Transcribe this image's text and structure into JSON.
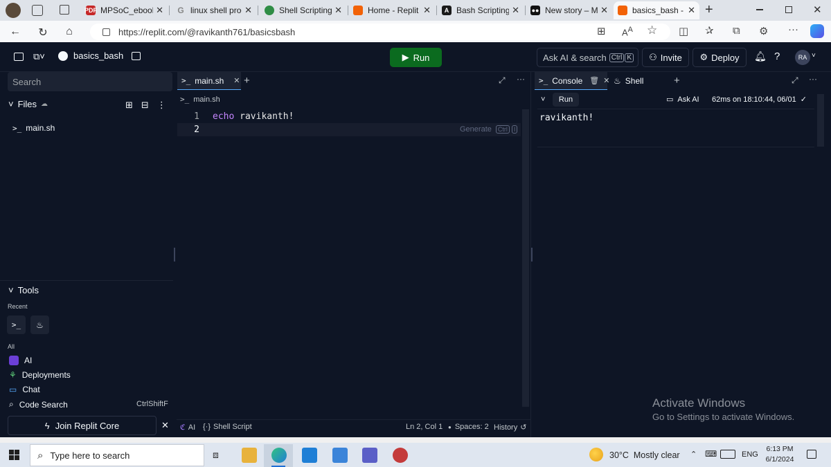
{
  "browser": {
    "tabs": [
      {
        "title": "MPSoC_ebook",
        "favicon": "pdf-icon",
        "color": "#c62828"
      },
      {
        "title": "linux shell prog",
        "favicon": "google-icon",
        "color": "#ffffff"
      },
      {
        "title": "Shell Scripting",
        "favicon": "green-circle-icon",
        "color": "#2f8d46"
      },
      {
        "title": "Home - Replit",
        "favicon": "replit-icon",
        "color": "#f26207"
      },
      {
        "title": "Bash Scripting",
        "favicon": "bash-a-icon",
        "color": "#1a1a1a"
      },
      {
        "title": "New story – Me",
        "favicon": "medium-icon",
        "color": "#111111"
      },
      {
        "title": "basics_bash - R",
        "favicon": "replit-icon",
        "color": "#f26207"
      }
    ],
    "url": "https://replit.com/@ravikanth761/basicsbash"
  },
  "replit": {
    "project_name": "basics_bash",
    "run_label": "Run",
    "ask_ai": "Ask AI & search",
    "ask_ai_kbd1": "Ctrl",
    "ask_ai_kbd2": "K",
    "invite": "Invite",
    "deploy": "Deploy",
    "avatar": "RA",
    "accent": "#0b6b1f"
  },
  "sidebar": {
    "search_placeholder": "Search",
    "files_header": "Files",
    "files": [
      {
        "name": "main.sh"
      }
    ],
    "tools_header": "Tools",
    "recent_label": "Recent",
    "all_label": "All",
    "tools": [
      {
        "name": "AI"
      },
      {
        "name": "Deployments"
      },
      {
        "name": "Chat"
      },
      {
        "name": "Code Search",
        "shortcut": "CtrlShiftF"
      }
    ],
    "join_core": "Join Replit Core"
  },
  "editor": {
    "tab_name": "main.sh",
    "breadcrumb": "main.sh",
    "lines": [
      {
        "num": "1",
        "code": "echo ravikanth!"
      },
      {
        "num": "2",
        "code": ""
      }
    ],
    "generate_hint": "Generate",
    "generate_kbd1": "Ctrl",
    "generate_kbd2": "I",
    "status": {
      "ai": "AI",
      "language": "Shell Script",
      "position": "Ln 2, Col 1",
      "spaces": "Spaces: 2",
      "history": "History"
    }
  },
  "console": {
    "tab_console": "Console",
    "tab_shell": "Shell",
    "run_label": "Run",
    "ask_ai": "Ask AI",
    "timing": "62ms on 18:10:44, 06/01",
    "output": "ravikanth!",
    "watermark_title": "Activate Windows",
    "watermark_sub": "Go to Settings to activate Windows."
  },
  "taskbar": {
    "search_placeholder": "Type here to search",
    "weather": "30°C  Mostly clear",
    "lang": "ENG",
    "time": "6:13 PM",
    "date": "6/1/2024"
  }
}
